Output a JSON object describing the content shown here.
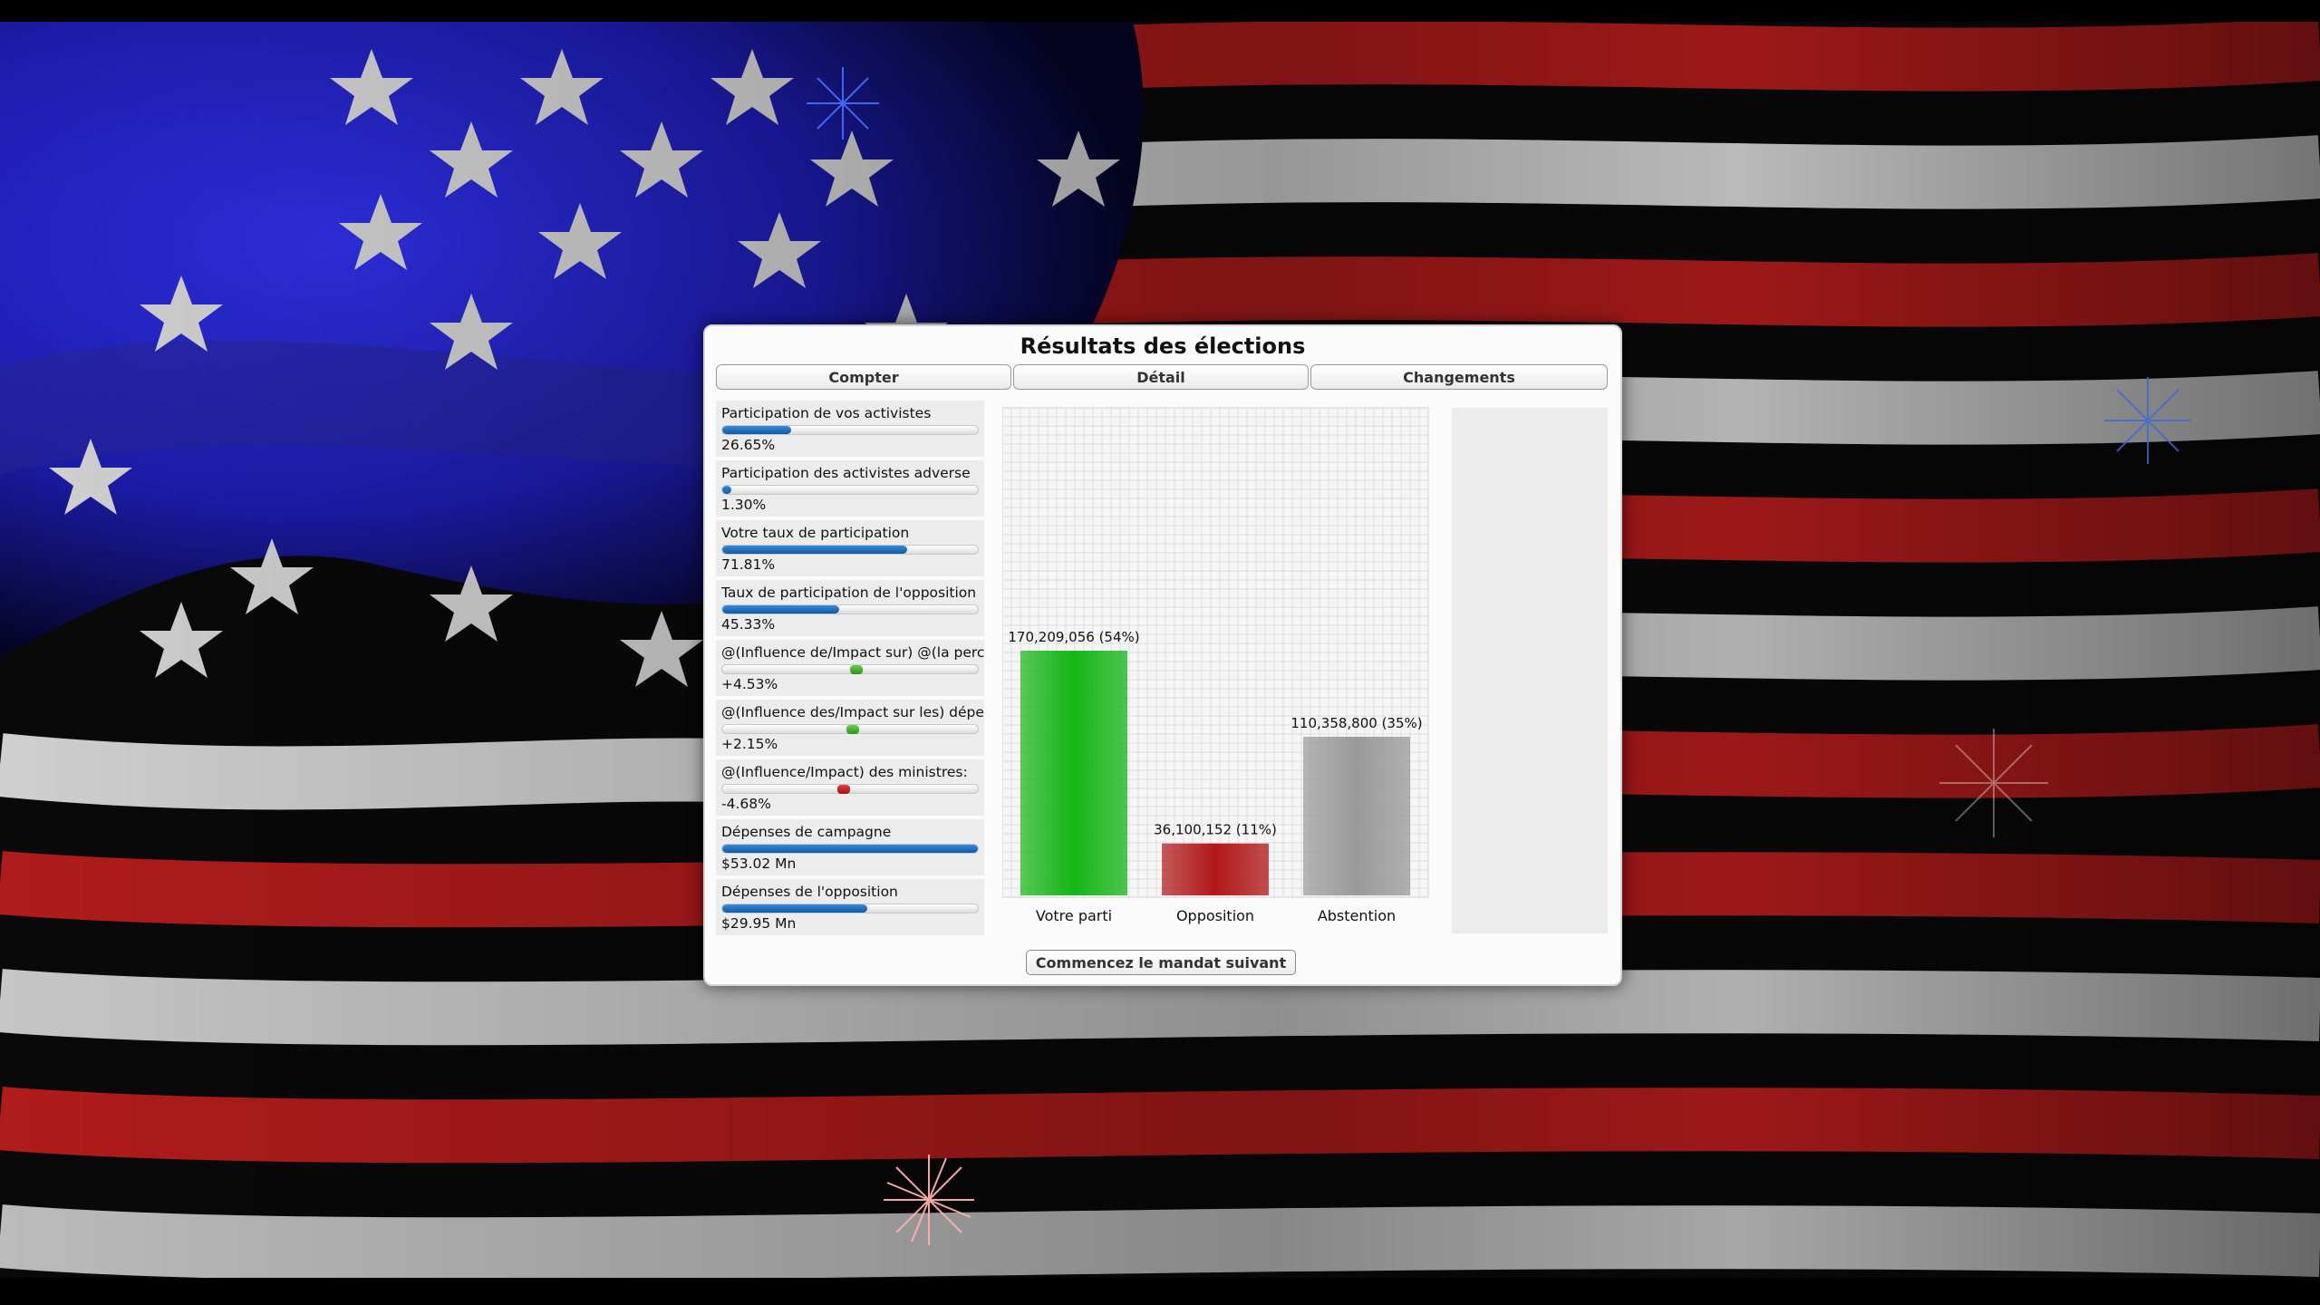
{
  "dialog": {
    "title": "Résultats des élections",
    "tabs": [
      "Compter",
      "Détail",
      "Changements"
    ],
    "next_button_label": "Commencez le mandat suivant"
  },
  "stats": [
    {
      "label": "Participation de vos activistes",
      "value": "26.65%",
      "kind": "bar",
      "level": 0.2665
    },
    {
      "label": "Participation des activistes adverse",
      "value": "1.30%",
      "kind": "bar",
      "level": 0.013
    },
    {
      "label": "Votre taux de participation",
      "value": "71.81%",
      "kind": "bar",
      "level": 0.7181
    },
    {
      "label": "Taux de participation de l'opposition",
      "value": "45.33%",
      "kind": "bar",
      "level": 0.4533
    },
    {
      "label": "@(Influence de/Impact sur) @(la perception",
      "value": "+4.53%",
      "kind": "delta",
      "level": 0.0453
    },
    {
      "label": "@(Influence des/Impact sur les) dépenses",
      "value": "+2.15%",
      "kind": "delta",
      "level": 0.0215
    },
    {
      "label": "@(Influence/Impact) des ministres:",
      "value": "-4.68%",
      "kind": "delta",
      "level": -0.0468
    },
    {
      "label": "Dépenses de campagne",
      "value": "$53.02 Mn",
      "kind": "bar",
      "level": 1.0
    },
    {
      "label": "Dépenses de l'opposition",
      "value": "$29.95 Mn",
      "kind": "bar",
      "level": 0.565
    }
  ],
  "colors": {
    "bar_fill": "#1a6cc0",
    "delta_positive": "#3f9f28",
    "delta_negative": "#b81818",
    "votre_parti": "#16b516",
    "opposition": "#b01818",
    "abstention": "#9a9a9a"
  },
  "chart_data": {
    "type": "bar",
    "categories": [
      "Votre parti",
      "Opposition",
      "Abstention"
    ],
    "values": [
      170209056,
      36100152,
      110358800
    ],
    "data_labels": [
      "170,209,056 (54%)",
      "36,100,152 (11%)",
      "110,358,800 (35%)"
    ],
    "grid": true
  }
}
